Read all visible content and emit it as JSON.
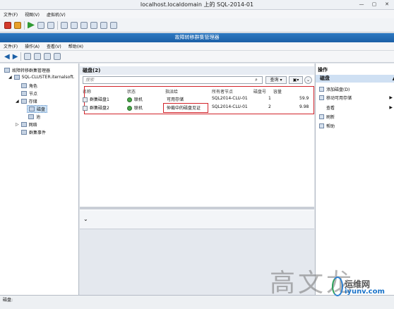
{
  "vm": {
    "title": "localhost.localdomain 上的 SQL-2014-01",
    "menu": [
      "文件(F)",
      "视图(V)",
      "虚拟机(V)"
    ]
  },
  "app": {
    "title": "故障转移群集管理器",
    "menu": [
      "文件(F)",
      "操作(A)",
      "查看(V)",
      "帮助(H)"
    ]
  },
  "tree": {
    "items": [
      {
        "label": "故障转移群集管理器"
      },
      {
        "label": "SQL-CLUSTER.iternalsoft."
      },
      {
        "label": "角色"
      },
      {
        "label": "节点"
      },
      {
        "label": "存储"
      },
      {
        "label": "磁盘"
      },
      {
        "label": "池"
      },
      {
        "label": "网络"
      },
      {
        "label": "群集事件"
      }
    ]
  },
  "disks": {
    "title": "磁盘(2)",
    "search_placeholder": "搜索",
    "query_label": "查询",
    "columns": [
      "名称",
      "状态",
      "指派给",
      "所有者节点",
      "磁盘号",
      "容量"
    ],
    "rows": [
      {
        "name": "群集磁盘1",
        "status": "联机",
        "assigned": "可用存储",
        "owner": "SQL2014-CLU-01",
        "disk_no": "1",
        "capacity": "59.9"
      },
      {
        "name": "群集磁盘2",
        "status": "联机",
        "assigned": "仲裁中的磁盘见证",
        "owner": "SQL2014-CLU-01",
        "disk_no": "2",
        "capacity": "9.98"
      }
    ]
  },
  "actions": {
    "header": "操作",
    "section": "磁盘",
    "items": [
      {
        "label": "添加磁盘(D)",
        "arrow": ""
      },
      {
        "label": "移动可用存储",
        "arrow": "▶"
      },
      {
        "label": "查看",
        "arrow": "▶"
      },
      {
        "label": "刷新",
        "arrow": ""
      },
      {
        "label": "帮助",
        "arrow": ""
      }
    ]
  },
  "status": {
    "text": "磁盘:"
  },
  "watermark": {
    "calligraphy": "高文龙",
    "site_cn": "运维网",
    "site_en": "iyunv.com"
  }
}
